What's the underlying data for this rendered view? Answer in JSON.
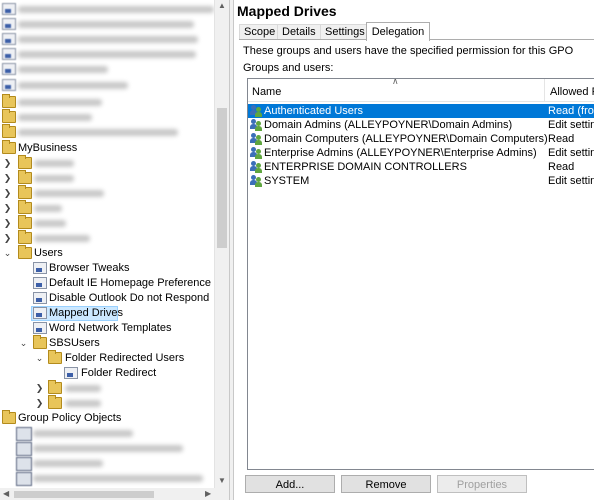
{
  "tree": {
    "my_business": "MyBusiness",
    "users": "Users",
    "browser_tweaks": "Browser Tweaks",
    "default_ie": "Default IE Homepage Preference",
    "disable_outlook": "Disable Outlook Do not Respond",
    "mapped_drives": "Mapped Drives",
    "word_network": "Word Network Templates",
    "sbs_users": "SBSUsers",
    "folder_redirected_users": "Folder Redirected Users",
    "folder_redirect": "Folder Redirect",
    "group_policy_objects": "Group Policy Objects"
  },
  "right": {
    "title": "Mapped Drives",
    "tabs": [
      "Scope",
      "Details",
      "Settings",
      "Delegation"
    ],
    "active_tab": "Delegation",
    "description": "These groups and users have the specified permission for this GPO",
    "groups_label": "Groups and users:",
    "columns": {
      "name": "Name",
      "allowed": "Allowed Pe"
    },
    "rows": [
      {
        "name": "Authenticated Users",
        "perm": "Read (from"
      },
      {
        "name": "Domain Admins (ALLEYPOYNER\\Domain Admins)",
        "perm": "Edit setting"
      },
      {
        "name": "Domain Computers (ALLEYPOYNER\\Domain Computers)",
        "perm": "Read"
      },
      {
        "name": "Enterprise Admins (ALLEYPOYNER\\Enterprise Admins)",
        "perm": "Edit setting"
      },
      {
        "name": "ENTERPRISE DOMAIN CONTROLLERS",
        "perm": "Read"
      },
      {
        "name": "SYSTEM",
        "perm": "Edit setting"
      }
    ],
    "buttons": {
      "add": "Add...",
      "remove": "Remove",
      "properties": "Properties"
    }
  },
  "colors": {
    "selection": "#0078d7",
    "tree_selection": "#cce8ff",
    "folder": "#e8c55a"
  },
  "icons": [
    "folder-icon",
    "gpo-icon",
    "user-group-icon",
    "expand-arrow-icon"
  ]
}
